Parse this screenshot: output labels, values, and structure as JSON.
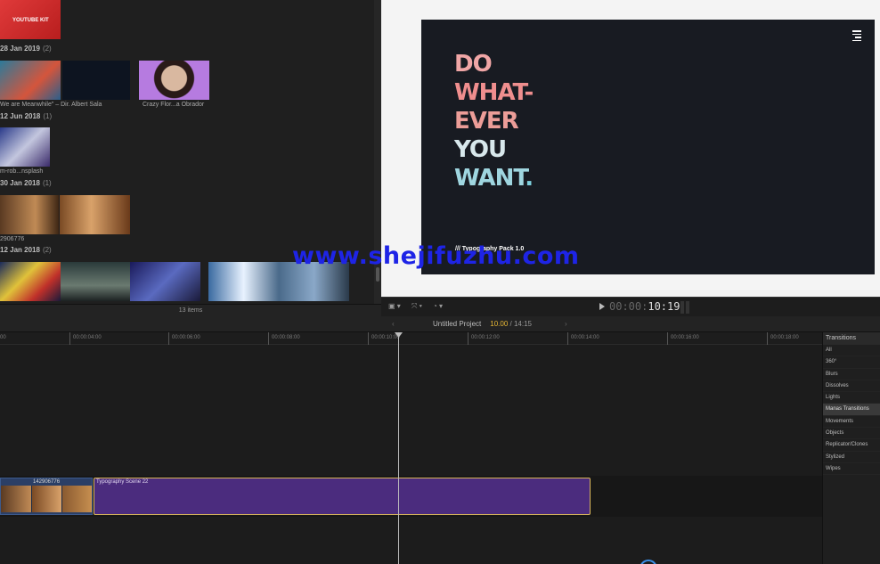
{
  "browser": {
    "groups": [
      {
        "date": "28 Jan 2019",
        "count": "(2)"
      },
      {
        "date": "12 Jun 2018",
        "count": "(1)"
      },
      {
        "date": "30 Jan 2018",
        "count": "(1)"
      },
      {
        "date": "12 Jan 2018",
        "count": "(2)"
      }
    ],
    "top_thumb_label": "YOUTUBE KIT",
    "captions": {
      "meanwhile": "We are Meanwhile\" – Dir. Albert Sala",
      "crazy": "Crazy Flor...a Obrador",
      "unsplash": "m-rob...nsplash",
      "clip_id": "2906776"
    },
    "items_count": "13 items"
  },
  "viewer": {
    "title_lines": [
      "DO",
      "WHAT-",
      "EVER",
      "YOU",
      "WANT"
    ],
    "title_dot": ".",
    "pack_label": "/// Typography Pack 1.0",
    "timecode_dim": "00:00:",
    "timecode": "10:19"
  },
  "timeline": {
    "project_name": "Untitled Project",
    "current_time": "10.00",
    "duration": "/ 14:15",
    "ruler": [
      "00",
      "00:00:04:00",
      "00:00:06:00",
      "00:00:08:00",
      "00:00:10:00",
      "00:00:12:00",
      "00:00:14:00",
      "00:00:16:00",
      "00:00:18:00"
    ],
    "clip_a_label": "142906776",
    "clip_b_label": "Typography Scene 22"
  },
  "transitions": {
    "header": "Transitions",
    "items": [
      "All",
      "360°",
      "Blurs",
      "Dissolves",
      "Lights",
      "Manas Transitions",
      "Movements",
      "Objects",
      "Replicator/Clones",
      "Stylized",
      "Wipes"
    ],
    "selected_index": 5
  },
  "watermark": "www.shejifuzhu.com"
}
